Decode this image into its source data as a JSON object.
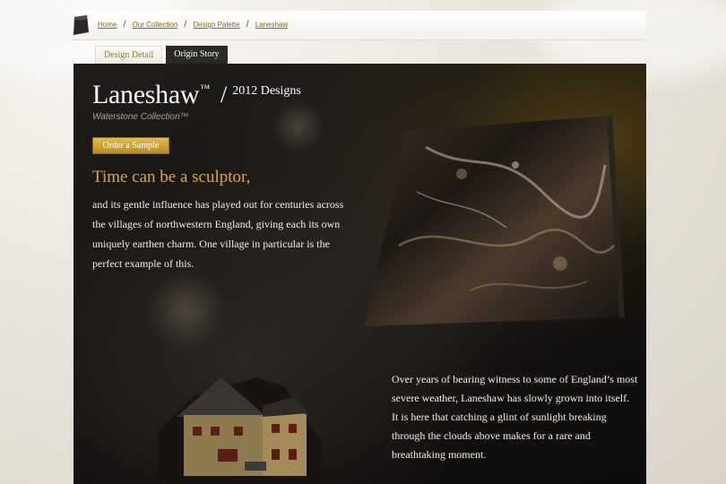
{
  "breadcrumb": {
    "items": [
      "Home",
      "Our Collection",
      "Design Palette",
      "Laneshaw"
    ],
    "separator": "/"
  },
  "tabs": [
    {
      "label": "Design Detail",
      "active": false
    },
    {
      "label": "Origin Story",
      "active": true
    }
  ],
  "hero": {
    "title": "Laneshaw",
    "trademark": "™",
    "slash": "/",
    "year_label": "2012 Designs",
    "collection": "Waterstone Collection™",
    "sample_button": "Order a Sample",
    "headline": "Time can be a sculptor,",
    "paragraph1": "and its gentle influence has played out for centuries across the villages of northwestern England, giving each its own uniquely earthen charm. One village in particular is the perfect example of this.",
    "paragraph2": "Over years of bearing witness to some of England’s most severe weather, Laneshaw has slowly grown into itself. It is here that catching a glint of sunlight breaking through the clouds above makes for a rare and breathtaking moment."
  },
  "colors": {
    "accent_gold": "#d6a84a",
    "link_gold": "#8a6a14",
    "button_gold": "#c99d2f",
    "stage_dark": "#151311"
  },
  "icons": [
    "logo-stone-icon"
  ]
}
